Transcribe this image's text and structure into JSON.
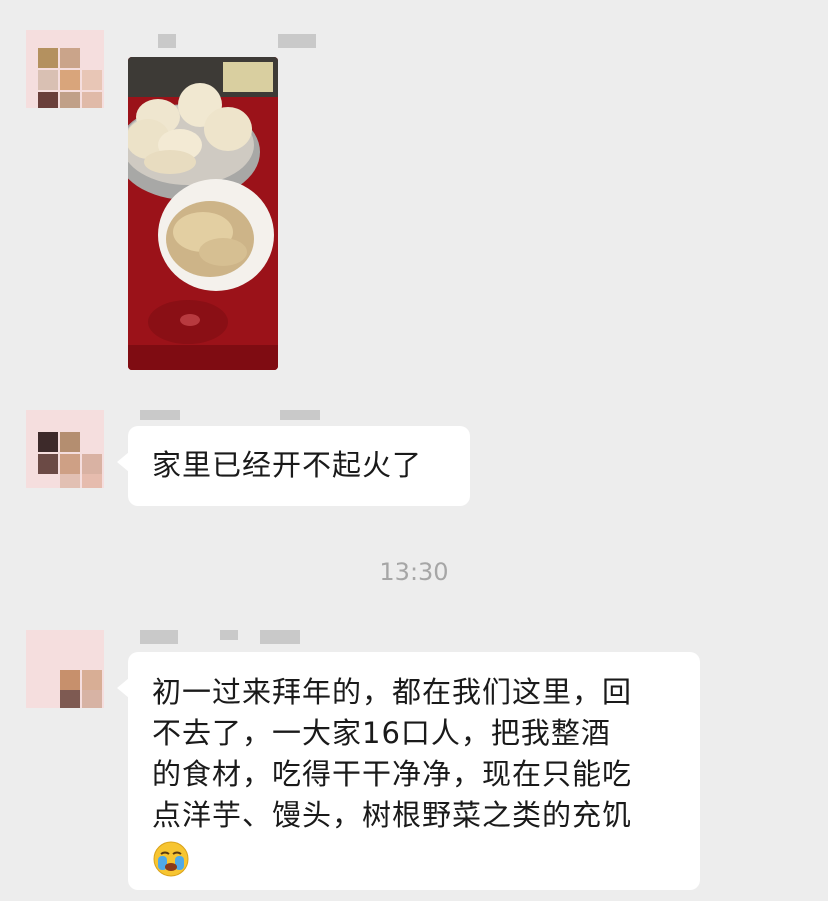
{
  "messages": [
    {
      "type": "image",
      "image_description": "dish of steamed buns and a bowl of noodles on a red table"
    },
    {
      "type": "text",
      "text": "家里已经开不起火了"
    },
    {
      "type": "timestamp",
      "text": "13:30"
    },
    {
      "type": "text",
      "lines": [
        "初一过来拜年的，都在我们这里，回",
        "不去了，一大家16口人，把我整酒",
        "的食材，吃得干干净净，现在只能吃",
        "点洋芋、馒头，树根野菜之类的充饥"
      ],
      "emoji": "crying-face-emoji"
    }
  ],
  "colors": {
    "background": "#ededed",
    "bubble": "#ffffff",
    "timestamp": "#a6a6a6",
    "tablecloth": "#9b1219"
  }
}
